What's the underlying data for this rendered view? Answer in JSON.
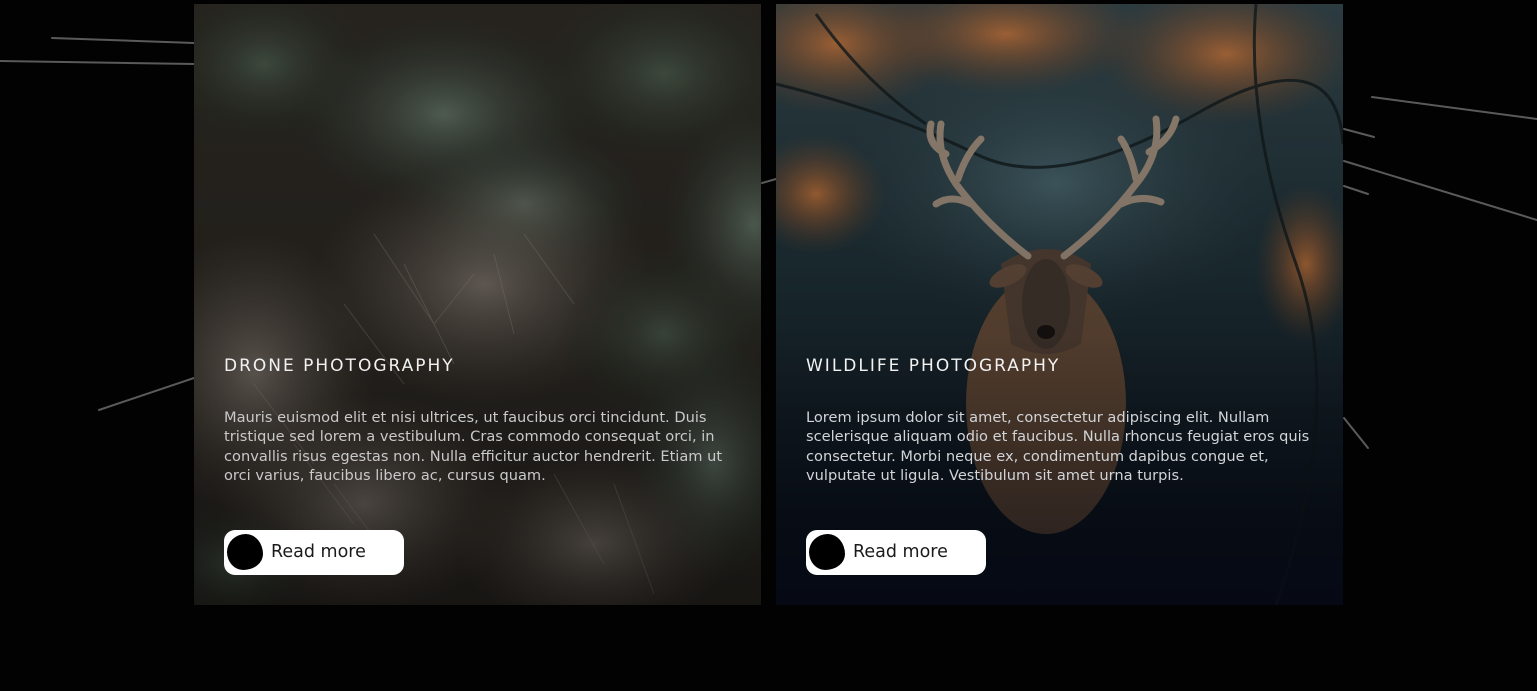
{
  "cards": [
    {
      "title": "DRONE PHOTOGRAPHY",
      "body": "Mauris euismod elit et nisi ultrices, ut faucibus orci tincidunt. Duis tristique sed lorem a vestibulum. Cras commodo consequat orci, in convallis risus egestas non. Nulla efficitur auctor hendrerit. Etiam ut orci varius, faucibus libero ac, cursus quam.",
      "button_label": "Read more",
      "image": "aerial-forest-photo"
    },
    {
      "title": "WILDLIFE PHOTOGRAPHY",
      "body": "Lorem ipsum dolor sit amet, consectetur adipiscing elit. Nullam scelerisque aliquam odio et faucibus. Nulla rhoncus feugiat eros quis consectetur. Morbi neque ex, condimentum dapibus congue et, vulputate ut ligula. Vestibulum sit amet urna turpis.",
      "button_label": "Read more",
      "image": "stag-in-forest-photo"
    }
  ],
  "colors": {
    "background": "#020202",
    "button": "#ffffff",
    "title": "#f2f2f2"
  }
}
